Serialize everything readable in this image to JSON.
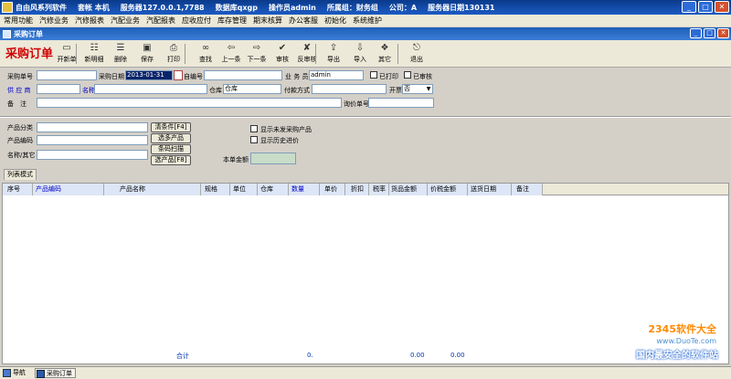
{
  "titlebar": {
    "app": "自由风系列软件",
    "account": "套帐 本机",
    "server": "服务器127.0.0.1,7788",
    "database": "数据库qxgp",
    "operator": "操作员admin",
    "group": "所属组：财务组",
    "company": "公司：A",
    "server_date": "服务器日期130131"
  },
  "menubar": [
    "常用功能",
    "汽修业务",
    "汽修报表",
    "汽配业务",
    "汽配报表",
    "应收应付",
    "库存管理",
    "期末核算",
    "办公客服",
    "初始化",
    "系统维护"
  ],
  "subwindow": {
    "title": "采购订单"
  },
  "toolbar": {
    "doc_title": "采购订单",
    "buttons": [
      {
        "label": "开新单",
        "icon": "new-doc-icon"
      },
      {
        "label": "新明细",
        "icon": "new-detail-icon"
      },
      {
        "label": "删除",
        "icon": "delete-icon"
      },
      {
        "label": "保存",
        "icon": "save-icon"
      },
      {
        "label": "打印",
        "icon": "print-icon"
      },
      {
        "label": "查找",
        "icon": "binoculars-icon"
      },
      {
        "label": "上一条",
        "icon": "arrow-left-icon"
      },
      {
        "label": "下一条",
        "icon": "arrow-right-icon"
      },
      {
        "label": "审核",
        "icon": "approve-icon"
      },
      {
        "label": "反审核",
        "icon": "unapprove-icon"
      },
      {
        "label": "导出",
        "icon": "export-icon"
      },
      {
        "label": "导入",
        "icon": "import-icon"
      },
      {
        "label": "其它",
        "icon": "other-icon"
      },
      {
        "label": "退出",
        "icon": "exit-icon"
      }
    ]
  },
  "form": {
    "order_no_label": "采购单号",
    "order_no": "",
    "date_label": "采购日期",
    "date_value": "2013-01-31",
    "self_no_label": "自编号",
    "self_no": "",
    "clerk_label": "业 务 员",
    "clerk": "admin",
    "printed_label": "已打印",
    "approved_label": "已审核",
    "supplier_label": "供 应 商",
    "supplier": "",
    "name_label": "名称",
    "name": "",
    "warehouse_label": "仓库",
    "warehouse": "仓库",
    "payment_label": "付款方式",
    "payment": "",
    "invoice_label": "开票",
    "invoice": "否",
    "remark_label": "备　注",
    "remark": "",
    "inquiry_label": "询价单号",
    "inquiry": ""
  },
  "product": {
    "category_label": "产品分类",
    "code_label": "产品编码",
    "name_label": "名称/其它",
    "btn_clear": "清条件[F4]",
    "btn_select": "选多产品",
    "btn_scan": "条码扫描",
    "btn_select_f8": "选产品[F8]",
    "chk_unpurchased": "显示未发采购产品",
    "chk_history": "显示历史进价",
    "total_label": "本单金额",
    "total_value": ""
  },
  "tab": {
    "label": "列表模式"
  },
  "grid": {
    "headers": [
      "序号",
      "产品编码",
      "产品名称",
      "规格",
      "单位",
      "仓库",
      "数量",
      "单价",
      "折扣",
      "税率",
      "货品金额",
      "价税金额",
      "送货日期",
      "备注"
    ],
    "footer_label": "合计",
    "footer_qty": "0.",
    "footer_amount": "0.00",
    "footer_tax_amount": "0.00"
  },
  "watermark": {
    "brand": "2345软件大全",
    "url": "www.DuoTe.com",
    "slogan": "国内最安全的软件站"
  },
  "statusbar": {
    "nav": "导航",
    "window": "采购订单"
  },
  "colors": {
    "title_gradient_start": "#0a3a8a",
    "title_gradient_end": "#1c5bc4",
    "doc_title_red": "#d10000",
    "selected_blue": "#0a246a"
  }
}
